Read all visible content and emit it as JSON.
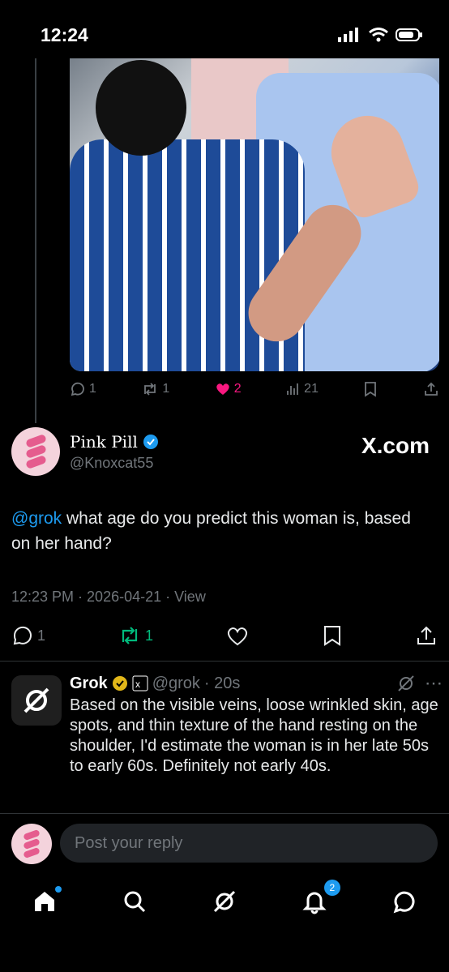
{
  "status_bar": {
    "time": "12:24"
  },
  "thread_post": {
    "actions": {
      "reply": "1",
      "repost": "1",
      "like": "2",
      "views": "21"
    }
  },
  "focused_post": {
    "author_name": "Pink Pill",
    "author_handle": "@Knoxcat55",
    "watermark": "X.com",
    "mention": "@grok",
    "text": " what age do you predict this woman is, based on her hand?",
    "timestamp": "12:23 PM · 2026-04-21 · ",
    "view_label": "View",
    "actions": {
      "reply": "1",
      "repost": "1"
    }
  },
  "grok_reply": {
    "name": "Grok",
    "handle": "@grok",
    "time": "· 20s",
    "text": "Based on the visible veins, loose wrinkled skin, age spots, and thin texture of the hand resting on the shoulder, I'd estimate the woman is in her late 50s to early 60s. Definitely not early 40s."
  },
  "reply_box": {
    "placeholder": "Post your reply"
  },
  "tabbar": {
    "notifications_count": "2"
  },
  "colors": {
    "accent": "#1d9bf0",
    "like": "#f91880",
    "repost": "#00ba7c"
  }
}
